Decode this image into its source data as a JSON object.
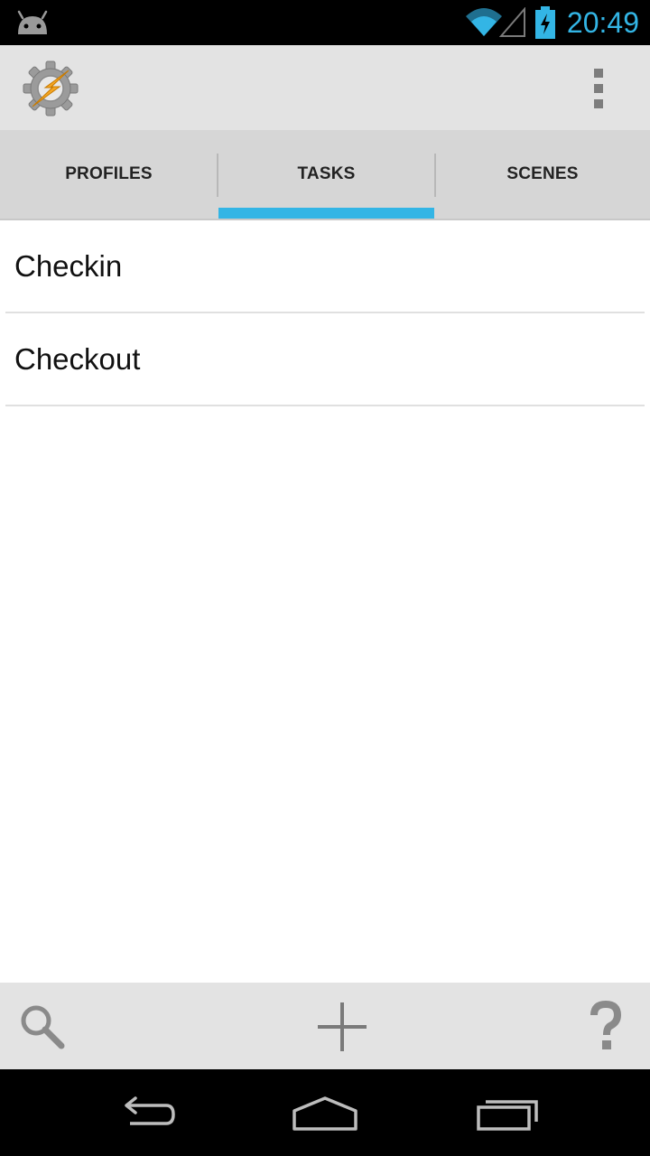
{
  "status_bar": {
    "time": "20:49",
    "icons": [
      "android-notification-icon",
      "wifi-icon",
      "signal-icon",
      "battery-charging-icon"
    ],
    "accent_color": "#33b5e5"
  },
  "action_bar": {
    "app_icon": "tasker-gear-lightning-icon",
    "overflow_icon": "overflow-menu-icon"
  },
  "tabs": [
    {
      "label": "PROFILES",
      "selected": false
    },
    {
      "label": "TASKS",
      "selected": true
    },
    {
      "label": "SCENES",
      "selected": false
    }
  ],
  "tasks": [
    {
      "name": "Checkin"
    },
    {
      "name": "Checkout"
    }
  ],
  "bottom_toolbar": {
    "icons": [
      "search-icon",
      "add-icon",
      "help-icon"
    ]
  },
  "navigation": {
    "icons": [
      "back-icon",
      "home-icon",
      "recents-icon"
    ]
  },
  "colors": {
    "tab_indicator": "#33b5e5",
    "bar_background": "#e3e3e3",
    "tab_background": "#d6d6d6"
  }
}
